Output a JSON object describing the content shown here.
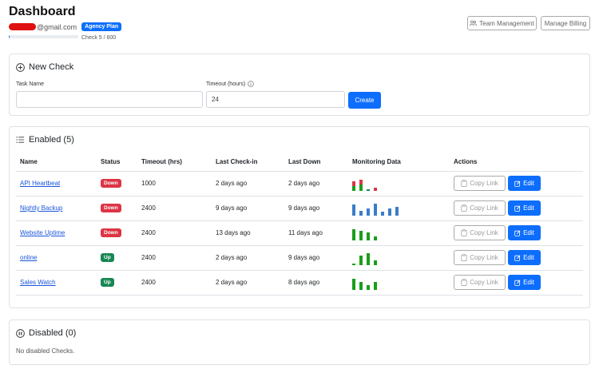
{
  "header": {
    "title": "Dashboard",
    "email_suffix": "@gmail.com",
    "plan_badge": "Agency Plan",
    "check_usage": "Check 5 / 600",
    "check_fraction": 0.0083,
    "team_button": "Team Management",
    "billing_button": "Manage Billing"
  },
  "new_check": {
    "title": "New Check",
    "task_label": "Task Name",
    "task_value": "",
    "timeout_label": "Timeout (hours)",
    "timeout_value": "24",
    "create_button": "Create"
  },
  "enabled": {
    "title": "Enabled (5)",
    "columns": [
      "Name",
      "Status",
      "Timeout (hrs)",
      "Last Check-in",
      "Last Down",
      "Monitoring Data",
      "Actions"
    ],
    "copy_label": "Copy Link",
    "edit_label": "Edit",
    "rows": [
      {
        "name": "API Heartbeat",
        "status": "Down",
        "timeout": "1000",
        "last_checkin": "2 days ago",
        "last_down": "2 days ago",
        "bars": [
          {
            "v": 0.75,
            "c": "#dc3545",
            "g": 0.5
          },
          {
            "v": 0.85,
            "c": "#dc3545",
            "g": 0.6
          },
          {
            "v": 0.15,
            "c": "#198754",
            "g": 1
          },
          {
            "v": 0.25,
            "c": "#dc3545",
            "g": 0
          }
        ]
      },
      {
        "name": "Nightly Backup",
        "status": "Down",
        "timeout": "2400",
        "last_checkin": "9 days ago",
        "last_down": "9 days ago",
        "bars": [
          {
            "v": 0.9,
            "c": "#3a7dc9"
          },
          {
            "v": 0.4,
            "c": "#3a7dc9"
          },
          {
            "v": 0.55,
            "c": "#3a7dc9"
          },
          {
            "v": 0.95,
            "c": "#3a7dc9"
          },
          {
            "v": 0.3,
            "c": "#3a7dc9"
          },
          {
            "v": 0.55,
            "c": "#3a7dc9"
          },
          {
            "v": 0.7,
            "c": "#3a7dc9"
          }
        ]
      },
      {
        "name": "Website Uptime",
        "status": "Down",
        "timeout": "2400",
        "last_checkin": "13 days ago",
        "last_down": "11 days ago",
        "bars": [
          {
            "v": 0.85,
            "c": "#1a9e1a"
          },
          {
            "v": 0.75,
            "c": "#1a9e1a"
          },
          {
            "v": 0.6,
            "c": "#1a9e1a"
          },
          {
            "v": 0.3,
            "c": "#1a9e1a"
          }
        ]
      },
      {
        "name": "online",
        "status": "Up",
        "timeout": "2400",
        "last_checkin": "2 days ago",
        "last_down": "9 days ago",
        "bars": [
          {
            "v": 0.1,
            "c": "#1a9e1a"
          },
          {
            "v": 0.75,
            "c": "#1a9e1a"
          },
          {
            "v": 0.95,
            "c": "#1a9e1a"
          },
          {
            "v": 0.35,
            "c": "#1a9e1a"
          }
        ]
      },
      {
        "name": "Sales Watch",
        "status": "Up",
        "timeout": "2400",
        "last_checkin": "2 days ago",
        "last_down": "8 days ago",
        "bars": [
          {
            "v": 0.85,
            "c": "#1a9e1a"
          },
          {
            "v": 0.6,
            "c": "#1a9e1a"
          },
          {
            "v": 0.35,
            "c": "#1a9e1a"
          },
          {
            "v": 0.65,
            "c": "#1a9e1a"
          }
        ]
      }
    ]
  },
  "disabled": {
    "title": "Disabled (0)",
    "empty_text": "No disabled Checks."
  }
}
